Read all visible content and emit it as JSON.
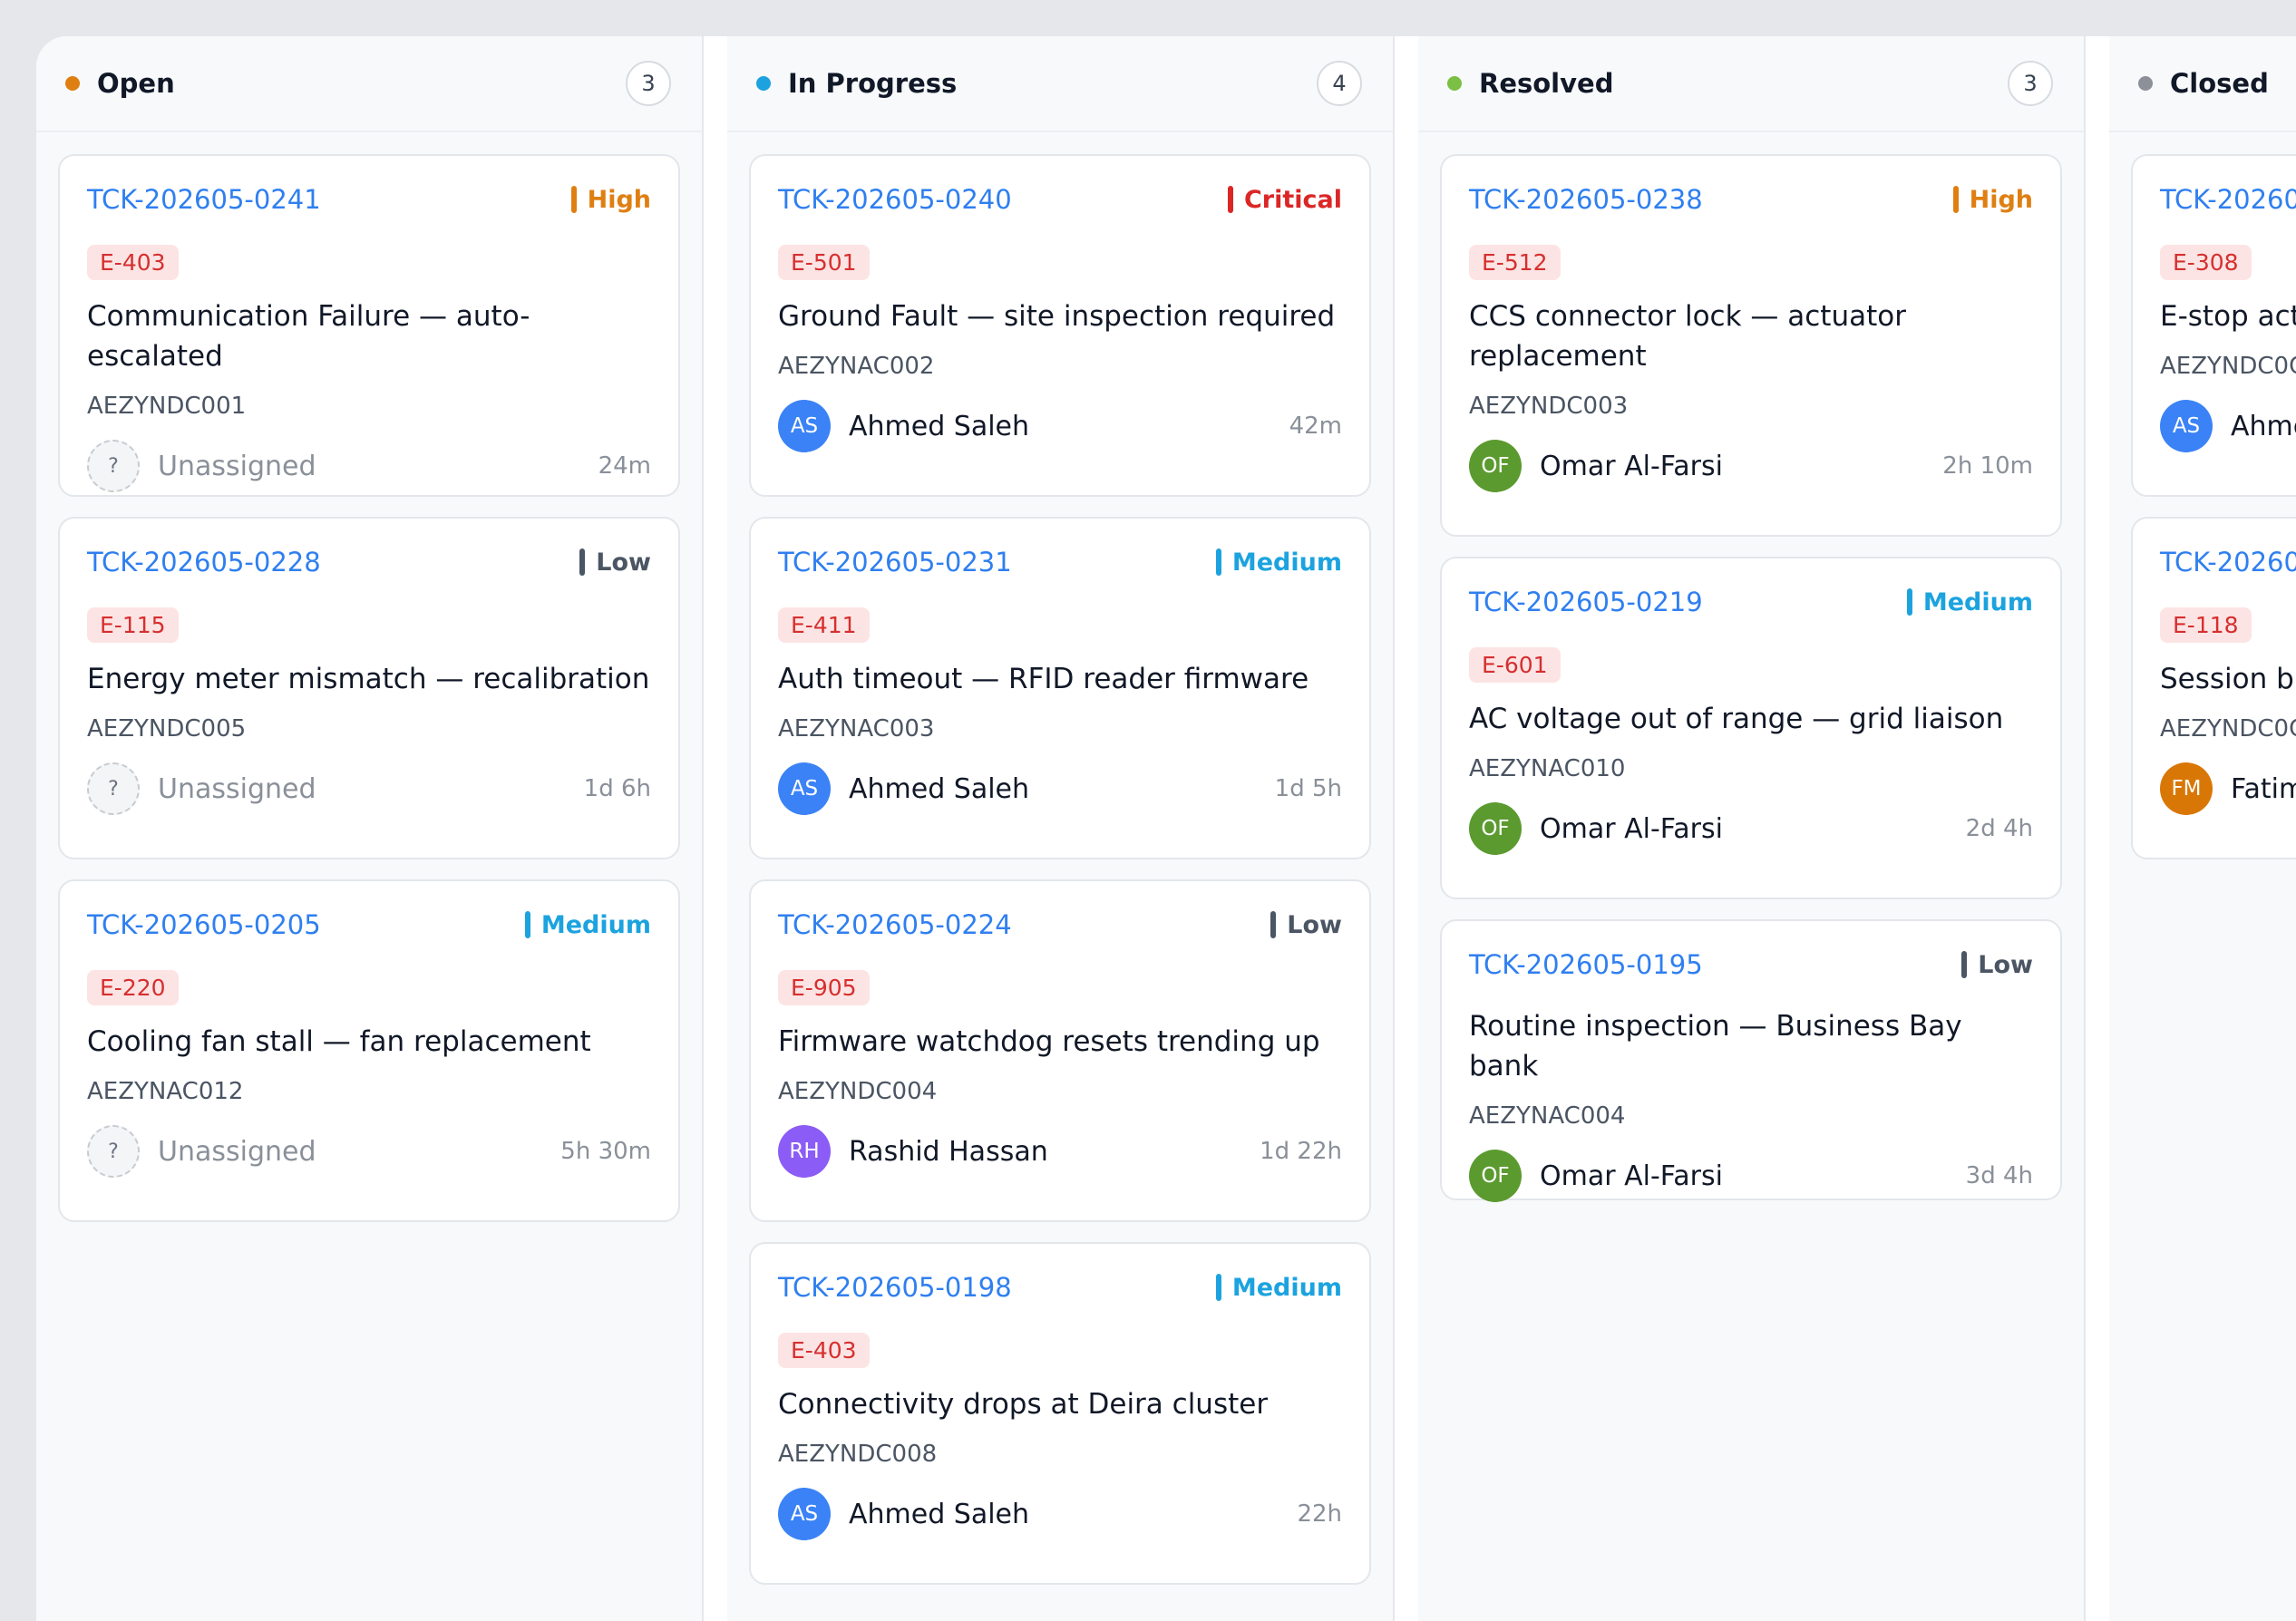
{
  "colors": {
    "open": "#df7f12",
    "in_progress": "#1ca3df",
    "resolved": "#7bc044",
    "closed": "#8b9099",
    "high": "#df7f12",
    "critical": "#dc2626",
    "medium": "#1ca3df",
    "low": "#4b5563"
  },
  "columns": [
    {
      "title": "Open",
      "count": "3",
      "color": "#df7f12",
      "cards": [
        {
          "id": "TCK-202605-0241",
          "priority": "High",
          "priority_color": "#df7f12",
          "error": "E-403",
          "title": "Communication Failure — auto-escalated",
          "charger": "AEZYNDC001",
          "initials": "?",
          "avatar_color": "",
          "assignee": "Unassigned",
          "unassigned": true,
          "age": "24m"
        },
        {
          "id": "TCK-202605-0228",
          "priority": "Low",
          "priority_color": "#4b5563",
          "error": "E-115",
          "title": "Energy meter mismatch — recalibration",
          "charger": "AEZYNDC005",
          "initials": "?",
          "avatar_color": "",
          "assignee": "Unassigned",
          "unassigned": true,
          "age": "1d 6h"
        },
        {
          "id": "TCK-202605-0205",
          "priority": "Medium",
          "priority_color": "#1ca3df",
          "error": "E-220",
          "title": "Cooling fan stall — fan replacement",
          "charger": "AEZYNAC012",
          "initials": "?",
          "avatar_color": "",
          "assignee": "Unassigned",
          "unassigned": true,
          "age": "5h 30m"
        }
      ]
    },
    {
      "title": "In Progress",
      "count": "4",
      "color": "#1ca3df",
      "cards": [
        {
          "id": "TCK-202605-0240",
          "priority": "Critical",
          "priority_color": "#dc2626",
          "error": "E-501",
          "title": "Ground Fault — site inspection required",
          "charger": "AEZYNAC002",
          "initials": "AS",
          "avatar_color": "#3b82f6",
          "assignee": "Ahmed Saleh",
          "unassigned": false,
          "age": "42m"
        },
        {
          "id": "TCK-202605-0231",
          "priority": "Medium",
          "priority_color": "#1ca3df",
          "error": "E-411",
          "title": "Auth timeout — RFID reader firmware",
          "charger": "AEZYNAC003",
          "initials": "AS",
          "avatar_color": "#3b82f6",
          "assignee": "Ahmed Saleh",
          "unassigned": false,
          "age": "1d 5h"
        },
        {
          "id": "TCK-202605-0224",
          "priority": "Low",
          "priority_color": "#4b5563",
          "error": "E-905",
          "title": "Firmware watchdog resets trending up",
          "charger": "AEZYNDC004",
          "initials": "RH",
          "avatar_color": "#8b5cf6",
          "assignee": "Rashid Hassan",
          "unassigned": false,
          "age": "1d 22h"
        },
        {
          "id": "TCK-202605-0198",
          "priority": "Medium",
          "priority_color": "#1ca3df",
          "error": "E-403",
          "title": "Connectivity drops at Deira cluster",
          "charger": "AEZYNDC008",
          "initials": "AS",
          "avatar_color": "#3b82f6",
          "assignee": "Ahmed Saleh",
          "unassigned": false,
          "age": "22h"
        }
      ]
    },
    {
      "title": "Resolved",
      "count": "3",
      "color": "#7bc044",
      "cards": [
        {
          "id": "TCK-202605-0238",
          "priority": "High",
          "priority_color": "#df7f12",
          "error": "E-512",
          "title": "CCS connector lock — actuator replacement",
          "charger": "AEZYNDC003",
          "initials": "OF",
          "avatar_color": "#5b9a2f",
          "assignee": "Omar Al-Farsi",
          "unassigned": false,
          "age": "2h 10m"
        },
        {
          "id": "TCK-202605-0219",
          "priority": "Medium",
          "priority_color": "#1ca3df",
          "error": "E-601",
          "title": "AC voltage out of range — grid liaison",
          "charger": "AEZYNAC010",
          "initials": "OF",
          "avatar_color": "#5b9a2f",
          "assignee": "Omar Al-Farsi",
          "unassigned": false,
          "age": "2d 4h"
        },
        {
          "id": "TCK-202605-0195",
          "priority": "Low",
          "priority_color": "#4b5563",
          "error": "",
          "title": "Routine inspection — Business Bay bank",
          "charger": "AEZYNAC004",
          "initials": "OF",
          "avatar_color": "#5b9a2f",
          "assignee": "Omar Al-Farsi",
          "unassigned": false,
          "age": "3d 4h"
        }
      ]
    },
    {
      "title": "Closed",
      "count": "",
      "color": "#8b9099",
      "cards": [
        {
          "id": "TCK-20260",
          "priority": "",
          "priority_color": "",
          "error": "E-308",
          "title": "E-stop act",
          "charger": "AEZYNDC0C",
          "initials": "AS",
          "avatar_color": "#3b82f6",
          "assignee": "Ahme",
          "unassigned": false,
          "age": ""
        },
        {
          "id": "TCK-20260",
          "priority": "",
          "priority_color": "",
          "error": "E-118",
          "title": "Session bil",
          "charger": "AEZYNDC0C",
          "initials": "FM",
          "avatar_color": "#d97706",
          "assignee": "Fatim",
          "unassigned": false,
          "age": ""
        }
      ]
    }
  ]
}
